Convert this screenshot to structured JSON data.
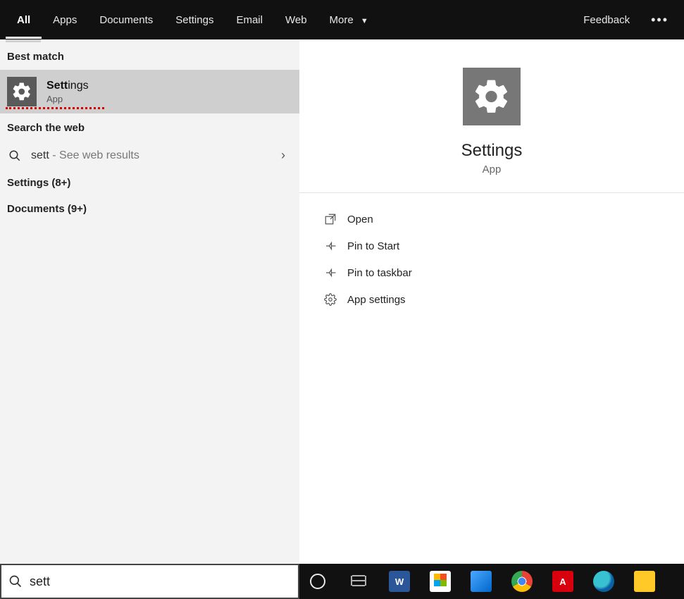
{
  "tabs": {
    "items": [
      "All",
      "Apps",
      "Documents",
      "Settings",
      "Email",
      "Web",
      "More"
    ],
    "active_index": 0,
    "feedback": "Feedback"
  },
  "left": {
    "best_match_label": "Best match",
    "best_match": {
      "title_bold": "Sett",
      "title_rest": "ings",
      "subtitle": "App"
    },
    "search_web_label": "Search the web",
    "web_row": {
      "query": "sett",
      "suffix": " - See web results"
    },
    "categories": [
      {
        "label": "Settings (8+)"
      },
      {
        "label": "Documents (9+)"
      }
    ]
  },
  "detail": {
    "title": "Settings",
    "subtitle": "App",
    "actions": [
      "Open",
      "Pin to Start",
      "Pin to taskbar",
      "App settings"
    ]
  },
  "search": {
    "value": "sett"
  },
  "taskbar": {
    "items": [
      "cortana",
      "task-view",
      "word",
      "store",
      "remote-desktop",
      "chrome",
      "adobe-reader",
      "edge",
      "file-explorer"
    ]
  }
}
